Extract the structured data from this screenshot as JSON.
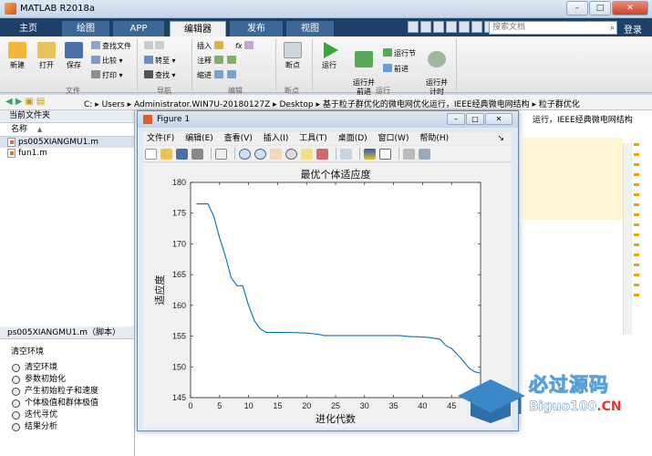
{
  "app": {
    "title": "MATLAB R2018a",
    "window_buttons": [
      "–",
      "□",
      "✕"
    ]
  },
  "ribbon_tabs": [
    "主页",
    "绘图",
    "APP",
    "编辑器",
    "发布",
    "视图"
  ],
  "search": {
    "placeholder": "搜索文档"
  },
  "login_label": "登录",
  "ribbon": {
    "file": {
      "new": "新建",
      "open": "打开",
      "save": "保存",
      "find_files": "查找文件",
      "compare": "比较",
      "print": "打印",
      "section": "文件"
    },
    "navigate": {
      "goto": "转至",
      "find": "查找",
      "section": "导航"
    },
    "edit": {
      "insert": "插入",
      "comment": "注释",
      "indent": "缩进",
      "fx": "fx",
      "section": "编辑"
    },
    "breakpoints": {
      "label": "断点",
      "section": "断点"
    },
    "run": {
      "run": "运行",
      "run_advance": "运行并\n前进",
      "run_section": "运行节",
      "advance": "前进",
      "run_time": "运行并\n计时",
      "section": "运行"
    }
  },
  "address": {
    "segments": [
      "C:",
      "Users",
      "Administrator.WIN7U-20180127Z",
      "Desktop",
      "基于粒子群优化的微电网优化运行，IEEE经典微电网结构",
      "粒子群优化"
    ]
  },
  "current_folder": {
    "title": "当前文件夹",
    "column_name": "名称",
    "column_sort": "▲",
    "files": [
      {
        "name": "ps005XIANGMU1.m"
      },
      {
        "name": "fun1.m"
      }
    ]
  },
  "details": {
    "title": "ps005XIANGMU1.m（脚本）",
    "header": "清空环境",
    "cells": [
      "清空环境",
      "参数初始化",
      "产生初始粒子和速度",
      "个体极值和群体极值",
      "迭代寻优",
      "结果分析"
    ]
  },
  "editor": {
    "path_tail": "运行，IEEE经典微电网结构"
  },
  "figure": {
    "title": "Figure 1",
    "menu": [
      "文件(F)",
      "编辑(E)",
      "查看(V)",
      "插入(I)",
      "工具(T)",
      "桌面(D)",
      "窗口(W)",
      "帮助(H)"
    ],
    "menu_close": "↘"
  },
  "chart_data": {
    "type": "line",
    "title": "最优个体适应度",
    "xlabel": "进化代数",
    "ylabel": "适应度",
    "xlim": [
      0,
      50
    ],
    "ylim": [
      145,
      180
    ],
    "xticks": [
      0,
      5,
      10,
      15,
      20,
      25,
      30,
      35,
      40,
      45
    ],
    "yticks": [
      145,
      150,
      155,
      160,
      165,
      170,
      175,
      180
    ],
    "grid": false,
    "series": [
      {
        "color": "#0072bd",
        "x": [
          1,
          2,
          3,
          4,
          5,
          6,
          7,
          8,
          9,
          10,
          11,
          12,
          13,
          14,
          15,
          17,
          20,
          22,
          23,
          24,
          25,
          28,
          32,
          36,
          38,
          39,
          41,
          43,
          44,
          45,
          46,
          47,
          48,
          49,
          50
        ],
        "y": [
          176.5,
          176.5,
          176.5,
          174.5,
          171,
          168,
          164.5,
          163.2,
          163.2,
          160,
          157.5,
          156.2,
          155.6,
          155.6,
          155.6,
          155.6,
          155.5,
          155.3,
          155.1,
          155.1,
          155.1,
          155.1,
          155.1,
          155.1,
          154.9,
          154.9,
          154.8,
          154.5,
          153.5,
          153.0,
          152.0,
          151.0,
          149.8,
          149.2,
          149.0
        ]
      }
    ]
  },
  "watermark": {
    "cn": "必过源码",
    "en_main": "Biguo100",
    "en_suffix": ".CN"
  }
}
